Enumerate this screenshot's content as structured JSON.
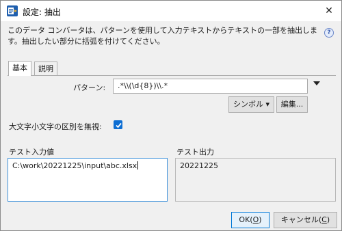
{
  "window": {
    "title": "設定: 抽出",
    "close_glyph": "✕"
  },
  "help": {
    "glyph": "?"
  },
  "description": "このデータ コンバータは、パターンを使用して入力テキストからテキストの一部を抽出します。抽出したい部分に括弧を付けてください。",
  "tabs": [
    {
      "label": "基本",
      "active": true
    },
    {
      "label": "説明",
      "active": false
    }
  ],
  "pattern": {
    "label": "パターン:",
    "value": ".*\\\\(\\d{8})\\\\.*"
  },
  "buttons": {
    "symbol": "シンボル ▾",
    "edit": "編集...",
    "ok_text": "OK(",
    "ok_key": "O",
    "ok_close": ")",
    "cancel_text": "キャンセル(",
    "cancel_key": "C",
    "cancel_close": ")"
  },
  "case_option": {
    "label": "大文字小文字の区別を無視:",
    "checked": true
  },
  "test_input": {
    "label": "テスト入力値",
    "value": "C:\\work\\20221225\\input\\abc.xlsx"
  },
  "test_output": {
    "label": "テスト出力",
    "value": "20221225"
  },
  "colors": {
    "accent": "#0d6ed3",
    "focus_border": "#3c8fd9",
    "primary_border": "#0078d7"
  },
  "icons": {
    "app": "app-icon",
    "close": "close-icon",
    "help": "help-icon",
    "dropdown": "dropdown-arrow-icon",
    "check": "checkmark-icon"
  }
}
